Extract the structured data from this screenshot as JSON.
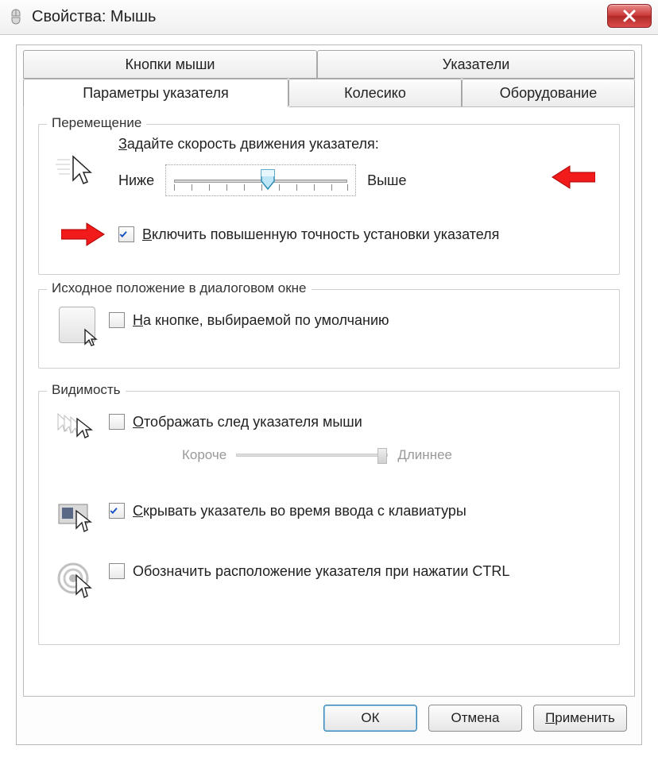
{
  "window": {
    "title": "Свойства: Мышь"
  },
  "tabs": {
    "buttons": "Кнопки мыши",
    "pointers": "Указатели",
    "params": "Параметры указателя",
    "wheel": "Колесико",
    "hardware": "Оборудование"
  },
  "motion": {
    "group": "Перемещение",
    "speed_label_pre": "З",
    "speed_label_rest": "адайте скорость движения указателя:",
    "slow": "Ниже",
    "fast": "Выше",
    "precision_pre": "В",
    "precision_rest": "ключить повышенную точность установки указателя",
    "precision_checked": true
  },
  "snap": {
    "group": "Исходное положение в диалоговом окне",
    "label_pre": "Н",
    "label_rest": "а кнопке, выбираемой по умолчанию",
    "checked": false
  },
  "visibility": {
    "group": "Видимость",
    "trail_pre": "О",
    "trail_rest": "тображать след указателя мыши",
    "trail_checked": false,
    "trail_short": "Короче",
    "trail_long": "Длиннее",
    "hide_pre": "С",
    "hide_rest": "крывать указатель во время ввода с клавиатуры",
    "hide_checked": true,
    "ctrl_pre": "",
    "ctrl_text": "Обозначить расположение указателя при нажатии CTRL",
    "ctrl_checked": false
  },
  "footer": {
    "ok": "ОК",
    "cancel": "Отмена",
    "apply_pre": "П",
    "apply_rest": "рименить"
  }
}
